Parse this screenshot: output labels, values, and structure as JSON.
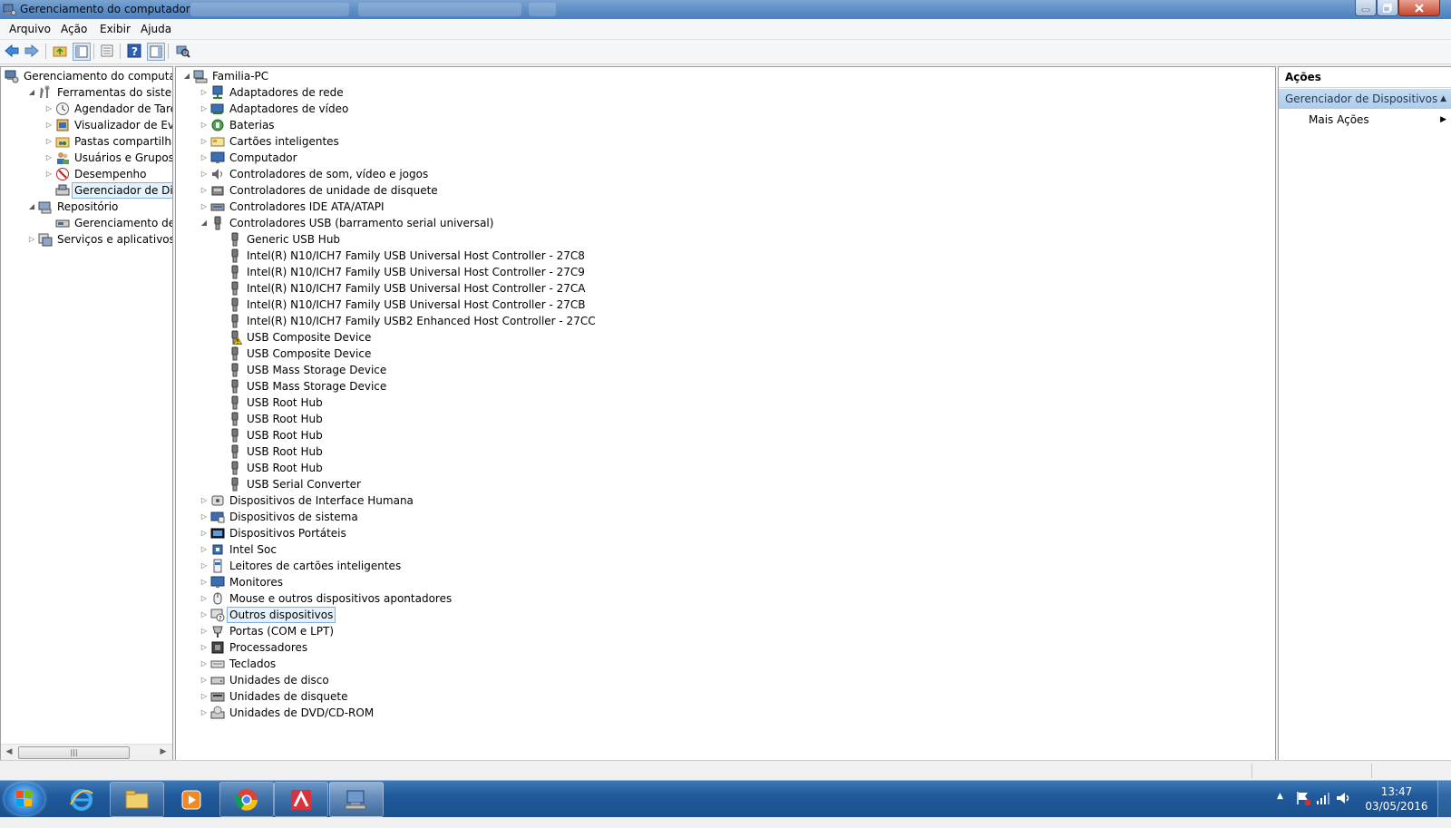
{
  "window": {
    "title": "Gerenciamento do computador"
  },
  "menubar": [
    "Arquivo",
    "Ação",
    "Exibir",
    "Ajuda"
  ],
  "left_tree": [
    {
      "label": "Gerenciamento do computado",
      "level": 0,
      "arrow": "",
      "icon": "computer-management-icon"
    },
    {
      "label": "Ferramentas do sistema",
      "level": 1,
      "arrow": "expanded",
      "icon": "system-tools-icon"
    },
    {
      "label": "Agendador de Tarefas",
      "level": 2,
      "arrow": "collapsed",
      "icon": "clock-icon"
    },
    {
      "label": "Visualizador de Eventos",
      "level": 2,
      "arrow": "collapsed",
      "icon": "event-viewer-icon"
    },
    {
      "label": "Pastas compartilhadas",
      "level": 2,
      "arrow": "collapsed",
      "icon": "shared-folder-icon"
    },
    {
      "label": "Usuários e Grupos Loca",
      "level": 2,
      "arrow": "collapsed",
      "icon": "users-icon"
    },
    {
      "label": "Desempenho",
      "level": 2,
      "arrow": "collapsed",
      "icon": "performance-icon"
    },
    {
      "label": "Gerenciador de Disposit",
      "level": 2,
      "arrow": "",
      "icon": "device-manager-icon",
      "selected": true
    },
    {
      "label": "Repositório",
      "level": 1,
      "arrow": "expanded",
      "icon": "storage-icon"
    },
    {
      "label": "Gerenciamento de disco",
      "level": 2,
      "arrow": "",
      "icon": "disk-management-icon"
    },
    {
      "label": "Serviços e aplicativos",
      "level": 1,
      "arrow": "collapsed",
      "icon": "services-icon"
    }
  ],
  "device_tree": {
    "root": "Familia-PC",
    "categories_before": [
      {
        "label": "Adaptadores de rede",
        "icon": "network-adapter-icon"
      },
      {
        "label": "Adaptadores de vídeo",
        "icon": "display-adapter-icon"
      },
      {
        "label": "Baterias",
        "icon": "battery-icon"
      },
      {
        "label": "Cartões inteligentes",
        "icon": "smart-card-icon"
      },
      {
        "label": "Computador",
        "icon": "computer-icon"
      },
      {
        "label": "Controladores de som, vídeo e jogos",
        "icon": "sound-icon"
      },
      {
        "label": "Controladores de unidade de disquete",
        "icon": "floppy-controller-icon"
      },
      {
        "label": "Controladores IDE ATA/ATAPI",
        "icon": "ide-controller-icon"
      }
    ],
    "expanded_category": {
      "label": "Controladores USB (barramento serial universal)",
      "icon": "usb-icon",
      "children": [
        {
          "label": "Generic USB Hub",
          "warning": false
        },
        {
          "label": "Intel(R) N10/ICH7 Family USB Universal Host Controller - 27C8",
          "warning": false
        },
        {
          "label": "Intel(R) N10/ICH7 Family USB Universal Host Controller - 27C9",
          "warning": false
        },
        {
          "label": "Intel(R) N10/ICH7 Family USB Universal Host Controller - 27CA",
          "warning": false
        },
        {
          "label": "Intel(R) N10/ICH7 Family USB Universal Host Controller - 27CB",
          "warning": false
        },
        {
          "label": "Intel(R) N10/ICH7 Family USB2 Enhanced Host Controller - 27CC",
          "warning": false
        },
        {
          "label": "USB Composite Device",
          "warning": true
        },
        {
          "label": "USB Composite Device",
          "warning": false
        },
        {
          "label": "USB Mass Storage Device",
          "warning": false
        },
        {
          "label": "USB Mass Storage Device",
          "warning": false
        },
        {
          "label": "USB Root Hub",
          "warning": false
        },
        {
          "label": "USB Root Hub",
          "warning": false
        },
        {
          "label": "USB Root Hub",
          "warning": false
        },
        {
          "label": "USB Root Hub",
          "warning": false
        },
        {
          "label": "USB Root Hub",
          "warning": false
        },
        {
          "label": "USB Serial Converter",
          "warning": false
        }
      ]
    },
    "categories_after": [
      {
        "label": "Dispositivos de Interface Humana",
        "icon": "hid-icon"
      },
      {
        "label": "Dispositivos de sistema",
        "icon": "system-devices-icon"
      },
      {
        "label": "Dispositivos Portáteis",
        "icon": "portable-devices-icon"
      },
      {
        "label": "Intel Soc",
        "icon": "chip-icon"
      },
      {
        "label": "Leitores de cartões inteligentes",
        "icon": "card-reader-icon"
      },
      {
        "label": "Monitores",
        "icon": "monitor-icon"
      },
      {
        "label": "Mouse e outros dispositivos apontadores",
        "icon": "mouse-icon"
      },
      {
        "label": "Outros dispositivos",
        "icon": "other-devices-icon",
        "selected": true
      },
      {
        "label": "Portas (COM e LPT)",
        "icon": "port-icon"
      },
      {
        "label": "Processadores",
        "icon": "processor-icon"
      },
      {
        "label": "Teclados",
        "icon": "keyboard-icon"
      },
      {
        "label": "Unidades de disco",
        "icon": "disk-drive-icon"
      },
      {
        "label": "Unidades de disquete",
        "icon": "floppy-drive-icon"
      },
      {
        "label": "Unidades de DVD/CD-ROM",
        "icon": "dvd-icon"
      }
    ]
  },
  "actions": {
    "title": "Ações",
    "group": "Gerenciador de Dispositivos",
    "item": "Mais Ações"
  },
  "taskbar": {
    "clock_time": "13:47",
    "clock_date": "03/05/2016",
    "apps": [
      "internet-explorer-icon",
      "file-explorer-icon",
      "media-player-icon",
      "chrome-icon",
      "app-icon",
      "computer-management-taskbar-icon"
    ]
  },
  "colors": {
    "selection": "#e5f1fb",
    "taskbar": "#1f5a9c",
    "actions_header": "#b0cbe8"
  }
}
